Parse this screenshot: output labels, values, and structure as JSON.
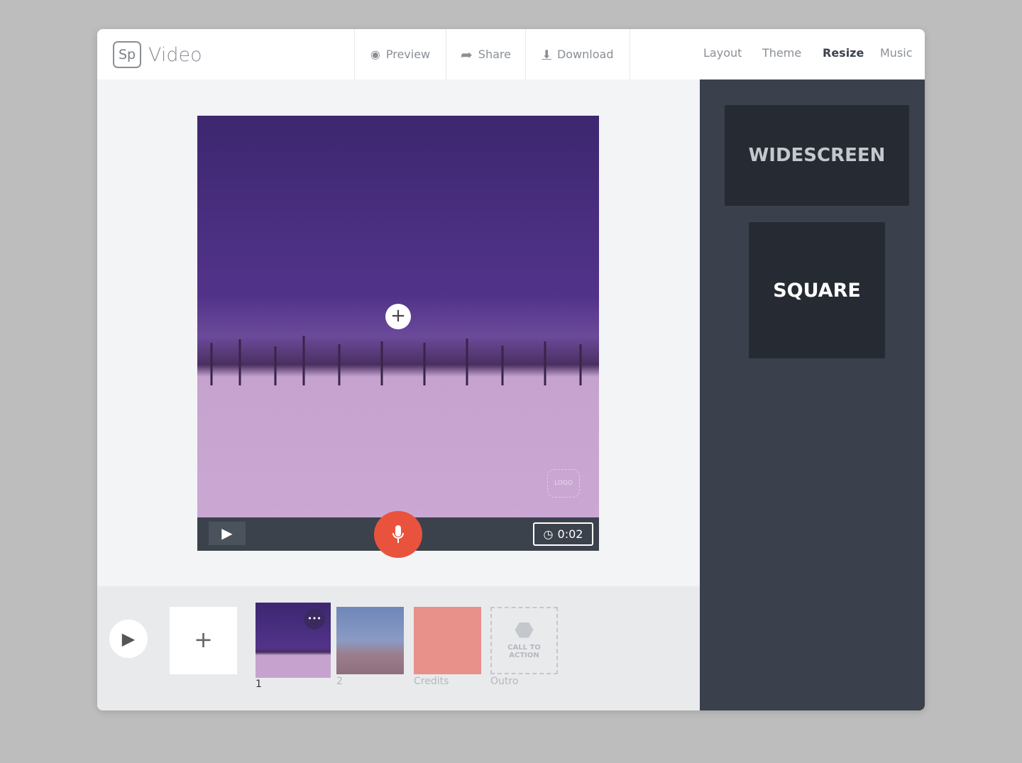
{
  "header": {
    "logo": "Sp",
    "app_name": "Video",
    "preview": "Preview",
    "share": "Share",
    "download": "Download",
    "nav": [
      {
        "label": "Layout"
      },
      {
        "label": "Theme"
      },
      {
        "label": "Resize"
      },
      {
        "label": "Music"
      }
    ],
    "active_nav": "Resize"
  },
  "stage": {
    "logo_badge": "LOGO",
    "duration": "0:02",
    "add": "+"
  },
  "timeline": {
    "add": "+",
    "slides": [
      {
        "label": "1"
      },
      {
        "label": "2"
      },
      {
        "label": "Credits"
      },
      {
        "label": "Outro"
      }
    ],
    "cta": "CALL TO ACTION",
    "more": "•••",
    "credits_color": "#e8908a"
  },
  "resize": {
    "options": [
      {
        "label": "WIDESCREEN"
      },
      {
        "label": "SQUARE"
      }
    ],
    "selected": "SQUARE"
  }
}
